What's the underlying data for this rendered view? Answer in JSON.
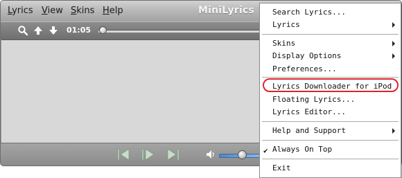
{
  "window": {
    "title": "MiniLyrics",
    "menu": [
      "Lyrics",
      "View",
      "Skins",
      "Help"
    ]
  },
  "toolbar": {
    "time": "01:05",
    "progress": 0.02,
    "volume": 0.55,
    "icons": [
      "search-icon",
      "arrow-up-icon",
      "arrow-down-icon"
    ]
  },
  "playback": {
    "icons": [
      "previous-icon",
      "play-icon",
      "next-icon",
      "volume-icon"
    ]
  },
  "context_menu": {
    "items": [
      {
        "label": "Search Lyrics...",
        "submenu": false
      },
      {
        "label": "Lyrics",
        "submenu": true
      },
      {
        "label": "Skins",
        "submenu": true
      },
      {
        "label": "Display Options",
        "submenu": true
      },
      {
        "label": "Preferences...",
        "submenu": false
      },
      {
        "label": "Lyrics Downloader for iPod",
        "submenu": false,
        "highlighted": true
      },
      {
        "label": "Floating Lyrics...",
        "submenu": false
      },
      {
        "label": "Lyrics Editor...",
        "submenu": false
      },
      {
        "label": "Help and Support",
        "submenu": true
      },
      {
        "label": "Always On Top",
        "submenu": false,
        "checked": true
      },
      {
        "label": "Exit",
        "submenu": false
      }
    ],
    "highlight_color": "#d8262a"
  }
}
